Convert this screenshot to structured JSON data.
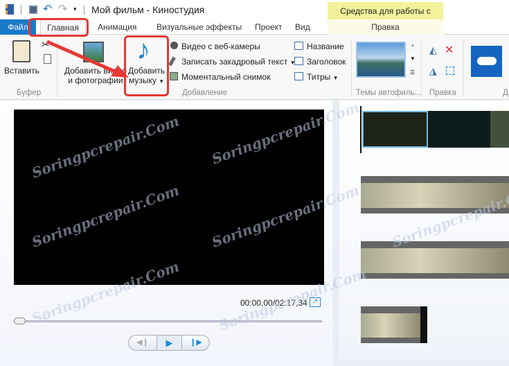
{
  "window": {
    "title": "Мой фильм - Киностудия",
    "context_tab_group": "Средства для работы с видео"
  },
  "tabs": [
    "Файл",
    "Главная",
    "Анимация",
    "Визуальные эффекты",
    "Проект",
    "Вид",
    "Правка"
  ],
  "ribbon": {
    "clipboard": {
      "paste": "Вставить",
      "label": "Буфер"
    },
    "add": {
      "add_video_line1": "Добавить видео",
      "add_video_line2": "и фотографии",
      "add_music_line1": "Добавить",
      "add_music_line2": "музыку",
      "webcam": "Видео с веб-камеры",
      "narration": "Записать закадровый текст",
      "snapshot": "Моментальный снимок",
      "title": "Название",
      "caption": "Заголовок",
      "credits": "Титры",
      "label": "Добавление"
    },
    "themes": {
      "label": "Темы автофиль..."
    },
    "edit": {
      "label": "Правка"
    },
    "share": {
      "label": "Д"
    }
  },
  "player": {
    "time": "00:00,00/02:17,34",
    "progress": 0
  },
  "watermark": "Soringpcrepair.Com",
  "colors": {
    "accent": "#1979ca",
    "highlight": "#e53935",
    "context": "#f3f19a"
  }
}
